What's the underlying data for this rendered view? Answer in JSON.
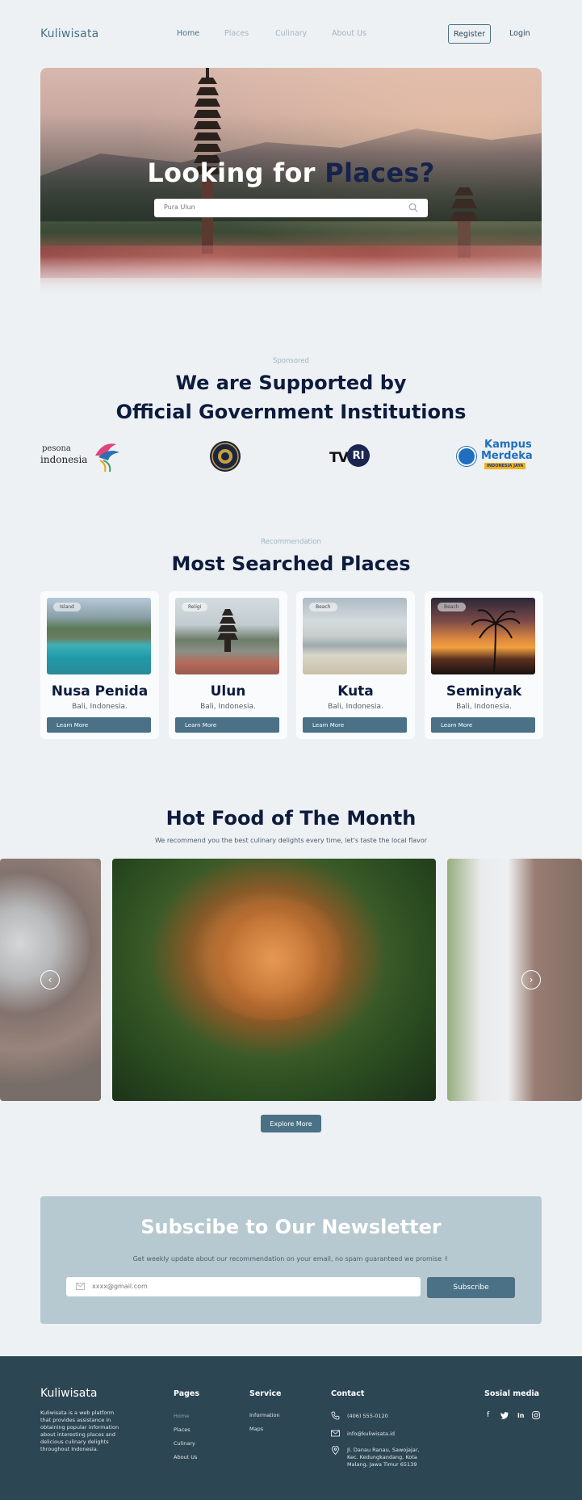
{
  "header": {
    "logo": "Kuliwisata",
    "nav": [
      "Home",
      "Places",
      "Culinary",
      "About Us"
    ],
    "register": "Register",
    "login": "Login"
  },
  "hero": {
    "title_prefix": "Looking for",
    "title_accent": "Places?",
    "search_placeholder": "Pura Ulun"
  },
  "sponsored": {
    "eyebrow": "Sponsored",
    "title_line1": "We are Supported by",
    "title_line2": "Official Government Institutions",
    "logos": {
      "pesona_top": "pesona",
      "pesona_bottom": "indonesia",
      "tvri_tv": "TV",
      "tvri_ri": "RI",
      "kampus_line1": "Kampus",
      "kampus_line2": "Merdeka",
      "kampus_line3": "INDONESIA JAYA"
    }
  },
  "recommendation": {
    "eyebrow": "Recommendation",
    "title": "Most Searched Places",
    "cards": [
      {
        "badge": "Island",
        "name": "Nusa Penida",
        "location": "Bali, Indonesia.",
        "button": "Learn More"
      },
      {
        "badge": "Religi",
        "name": "Ulun",
        "location": "Bali, Indonesia.",
        "button": "Learn More"
      },
      {
        "badge": "Beach",
        "name": "Kuta",
        "location": "Bali, Indonesia.",
        "button": "Learn More"
      },
      {
        "badge": "Beach",
        "name": "Seminyak",
        "location": "Bali, Indonesia.",
        "button": "Learn More"
      }
    ]
  },
  "food": {
    "title": "Hot Food of The Month",
    "subtitle": "We recommend you the best culinary delights every time, let's taste the local flavor",
    "explore": "Explore More"
  },
  "newsletter": {
    "title": "Subscibe to Our Newsletter",
    "subtitle": "Get weekly update about our recommendation on your email, no spam guaranteed we promise ✌",
    "email_placeholder": "xxxx@gmail.com",
    "button": "Subscribe"
  },
  "footer": {
    "logo": "Kuliwisata",
    "description": "Kuliwisata is a web platform that provides assistance in obtaining popular information about interesting places and delicious culinary delights throughout Indonesia.",
    "pages_title": "Pages",
    "pages": [
      "Home",
      "Places",
      "Culinary",
      "About Us"
    ],
    "service_title": "Service",
    "service": [
      "Information",
      "Maps"
    ],
    "contact_title": "Contact",
    "phone": "(406) 555-0120",
    "email": "info@kuliwisata.id",
    "address": "Jl. Danau Ranau, Sawojajar, Kec. Kedungkandang, Kota Malang, Jawa Timur 65139",
    "social_title": "Sosial media",
    "social": [
      "f",
      "t",
      "in",
      "ig"
    ]
  }
}
